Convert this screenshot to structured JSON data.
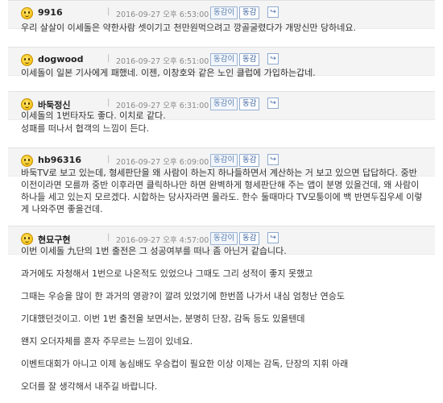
{
  "ui": {
    "like_label": "동감이",
    "dislike_label": "동감",
    "reply_arrow": "↪",
    "separator": "|"
  },
  "comments": [
    {
      "username": "9916",
      "timestamp": "2016-09-27 오후 6:53:00",
      "lines": [
        "우리 살살이 이세돌은 약한사람 셋이기고 천만원먹으려고 깡골굴렸다가 개망신만 당하네요."
      ]
    },
    {
      "username": "dogwood",
      "timestamp": "2016-09-27 오후 6:51:00",
      "lines": [
        "이세돌이 일본 기사에게 패했네. 이젠, 이창호와 같은 노인 클럽에 가입하는갑네."
      ]
    },
    {
      "username": "바둑정신",
      "timestamp": "2016-09-27 오후 6:31:00",
      "lines": [
        "이세돌의 1번타자도 좋다. 이치로 같다.",
        "성패를 떠나서 협객의 느낌이 든다."
      ]
    },
    {
      "username": "hb96316",
      "timestamp": "2016-09-27 오후 6:09:00",
      "lines": [
        "바둑TV로 보고 있는데, 형세판단을 왜 사람이 하는지 하나들하면서 계산하는 거 보고 있으면 답답하다. 중반",
        "이전이라면 모를까 중반 이후라면 클릭하나만 하면 완벽하게 형세판단해 주는 앱이 분명 있을건데, 왜 사람이",
        "하나들 세고 있는지 모르겠다. 시합하는 당사자라면 몰라도. 한수 둘때마다 TV모퉁이에 백 반면두집우세 이렇",
        "게 나와주면 좋을건데."
      ]
    },
    {
      "username": "현묘구현",
      "timestamp": "2016-09-27 오후 4:57:00",
      "lines": [
        "이번 이세돌 九단의 1번 출전은 그 성공여부를 떠나 좀 아닌거 같습니다.",
        "과거에도 자청해서 1번으로 나온적도 있었으나 그때도 그리 성적이 좋지 못했고",
        "그때는 우승을 많이 한 과거의 영광?이 깔려 있었기에 한번쯤 나가서 내심 엄청난 연승도",
        "기대했던것이고. 이번 1번 출전을 보면서는, 분명히 단장, 감독 등도 있을텐데",
        "왠지 오더자체를 혼자 주무르는 느낌이 있네요.",
        "이벤트대회가 아니고 이제 농심배도 우승컵이 필요한 이상 이제는 감독, 단장의 지휘 아래",
        "오더를 잘 생각해서 내주길 바랍니다."
      ]
    }
  ]
}
